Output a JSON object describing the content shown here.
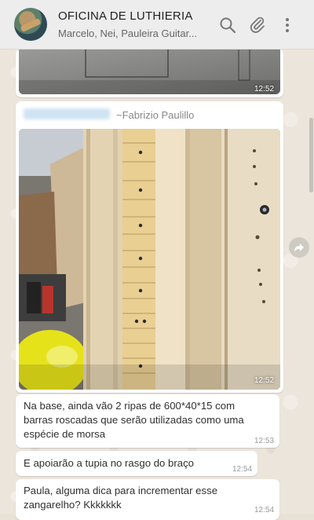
{
  "header": {
    "title": "OFICINA DE LUTHIERIA",
    "subtitle": "Marcelo, Nei, Pauleira Guitar...",
    "icons": [
      "search-icon",
      "attach-icon",
      "menu-icon"
    ]
  },
  "messages": [
    {
      "type": "image",
      "time": "12:52"
    },
    {
      "type": "image",
      "sender": "~Fabrizio Paulillo",
      "time": "12:52"
    },
    {
      "type": "text",
      "lines": [
        "Na base, ainda vão 2 ripas de 600*40*15 com",
        "barras roscadas que serão utilizadas como uma",
        "espécie de morsa"
      ],
      "time": "12:53"
    },
    {
      "type": "text",
      "lines": [
        "E apoiarão a tupia no rasgo do braço"
      ],
      "time": "12:54"
    },
    {
      "type": "text",
      "lines": [
        "Paula, alguma dica para incrementar esse",
        "zangarelho? Kkkkkkk"
      ],
      "time": "12:54"
    }
  ],
  "colors": {
    "header_bg": "#ededed",
    "chat_bg": "#ebe5db",
    "bubble_bg": "#ffffff"
  }
}
